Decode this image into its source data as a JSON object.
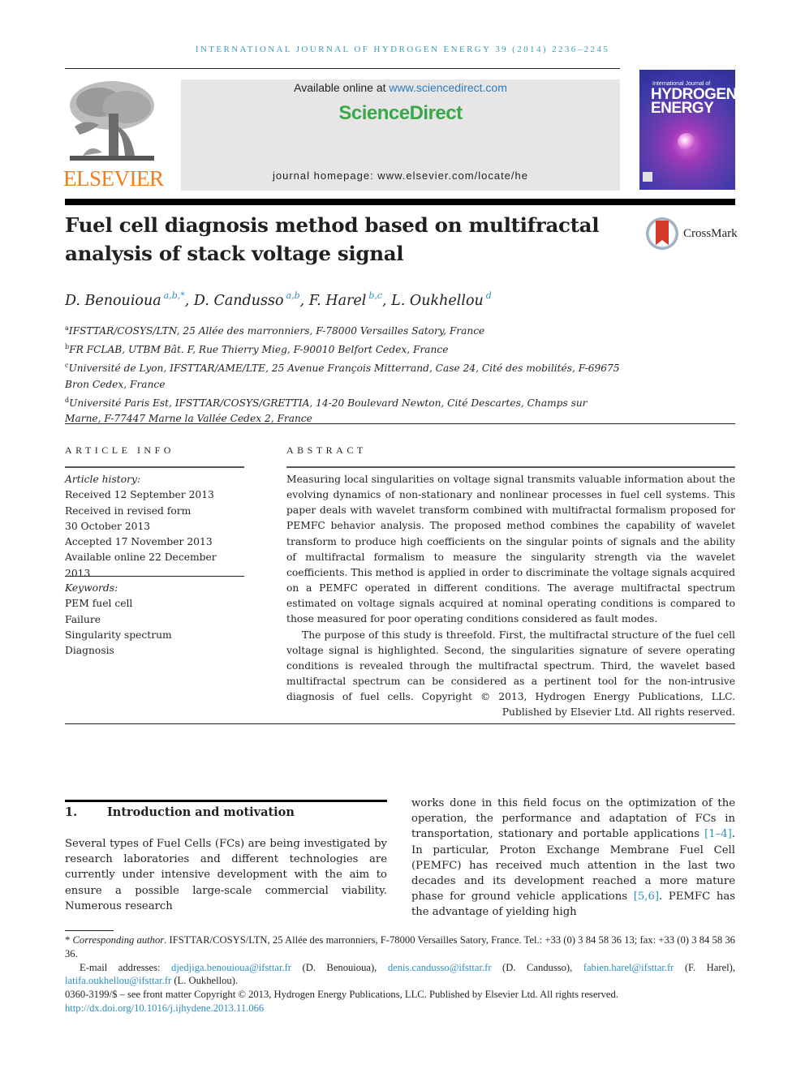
{
  "header": {
    "journal_line": "INTERNATIONAL JOURNAL OF HYDROGEN ENERGY 39 (2014) 2236–2245",
    "publisher_logo_text": "ELSEVIER",
    "available_prefix": "Available online at ",
    "available_link": "www.sciencedirect.com",
    "brand": "ScienceDirect",
    "homepage": "journal homepage: www.elsevier.com/locate/he",
    "cover": {
      "line1": "International Journal of",
      "line2": "HYDROGEN",
      "line3": "ENERGY"
    },
    "colors": {
      "journal_line": "#3a9bbd",
      "elsevier": "#f07c1e",
      "sciencedirect": "#3aa84a",
      "link": "#2a7bbf"
    }
  },
  "article": {
    "title": "Fuel cell diagnosis method based on multifractal analysis of stack voltage signal",
    "crossmark_label": "CrossMark",
    "authors": [
      {
        "name": "D. Benouioua",
        "affil": "a,b,*",
        "sep": ", "
      },
      {
        "name": "D. Candusso",
        "affil": "a,b",
        "sep": ", "
      },
      {
        "name": "F. Harel",
        "affil": "b,c",
        "sep": ", "
      },
      {
        "name": "L. Oukhellou",
        "affil": "d",
        "sep": ""
      }
    ],
    "affiliations": [
      {
        "key": "a",
        "text": "IFSTTAR/COSYS/LTN, 25 Allée des marronniers, F-78000 Versailles Satory, France"
      },
      {
        "key": "b",
        "text": "FR FCLAB, UTBM Bât. F, Rue Thierry Mieg, F-90010 Belfort Cedex, France"
      },
      {
        "key": "c",
        "text": "Université de Lyon, IFSTTAR/AME/LTE, 25 Avenue François Mitterrand, Case 24, Cité des mobilités, F-69675 Bron Cedex, France"
      },
      {
        "key": "d",
        "text": "Université Paris Est, IFSTTAR/COSYS/GRETTIA, 14-20 Boulevard Newton, Cité Descartes, Champs sur Marne, F-77447 Marne la Vallée Cedex 2, France"
      }
    ]
  },
  "article_info": {
    "label": "ARTICLE INFO",
    "history_label": "Article history:",
    "history": [
      "Received 12 September 2013",
      "Received in revised form",
      "30 October 2013",
      "Accepted 17 November 2013",
      "Available online 22 December 2013"
    ],
    "keywords_label": "Keywords:",
    "keywords": [
      "PEM fuel cell",
      "Failure",
      "Singularity spectrum",
      "Diagnosis"
    ]
  },
  "abstract": {
    "label": "ABSTRACT",
    "para1": "Measuring local singularities on voltage signal transmits valuable information about the evolving dynamics of non-stationary and nonlinear processes in fuel cell systems. This paper deals with wavelet transform combined with multifractal formalism proposed for PEMFC behavior analysis. The proposed method combines the capability of wavelet transform to produce high coefficients on the singular points of signals and the ability of multifractal formalism to measure the singularity strength via the wavelet coefficients. This method is applied in order to discriminate the voltage signals acquired on a PEMFC operated in different conditions. The average multifractal spectrum estimated on voltage signals acquired at nominal operating conditions is compared to those measured for poor operating conditions considered as fault modes.",
    "para2": "The purpose of this study is threefold. First, the multifractal structure of the fuel cell voltage signal is highlighted. Second, the singularities signature of severe operating conditions is revealed through the multifractal spectrum. Third, the wavelet based multifractal spectrum can be considered as a pertinent tool for the non-intrusive diagnosis of fuel cells. Copyright © 2013, Hydrogen Energy Publications, LLC. Published by Elsevier Ltd. All rights reserved."
  },
  "section1": {
    "number": "1.",
    "heading": "Introduction and motivation",
    "col1": "Several types of Fuel Cells (FCs) are being investigated by research laboratories and different technologies are currently under intensive development with the aim to ensure a possible large-scale commercial viability. Numerous research",
    "col2_a": "works done in this field focus on the optimization of the operation, the performance and adaptation of FCs in transportation, stationary and portable applications ",
    "col2_cite1": "[1–4]",
    "col2_b": ". In particular, Proton Exchange Membrane Fuel Cell (PEMFC) has received much attention in the last two decades and its development reached a more mature phase for ground vehicle applications ",
    "col2_cite2": "[5,6]",
    "col2_c": ". PEMFC has the advantage of yielding high"
  },
  "footnotes": {
    "corr_marker": "* ",
    "corr_label": "Corresponding author",
    "corr_text": ". IFSTTAR/COSYS/LTN, 25 Allée des marronniers, F-78000 Versailles Satory, France. Tel.: +33 (0) 3 84 58 36 13; fax: +33 (0) 3 84 58 36 36.",
    "email_label": "E-mail addresses: ",
    "emails": [
      {
        "address": "djedjiga.benouioua@ifsttar.fr",
        "owner": " (D. Benouioua), "
      },
      {
        "address": "denis.candusso@ifsttar.fr",
        "owner": " (D. Candusso), "
      },
      {
        "address": "fabien.harel@ifsttar.fr",
        "owner": " (F. Harel), "
      },
      {
        "address": "latifa.oukhellou@ifsttar.fr",
        "owner": " (L. Oukhellou)."
      }
    ],
    "issn_line": "0360-3199/$ – see front matter Copyright © 2013, Hydrogen Energy Publications, LLC. Published by Elsevier Ltd. All rights reserved.",
    "doi": "http://dx.doi.org/10.1016/j.ijhydene.2013.11.066"
  }
}
